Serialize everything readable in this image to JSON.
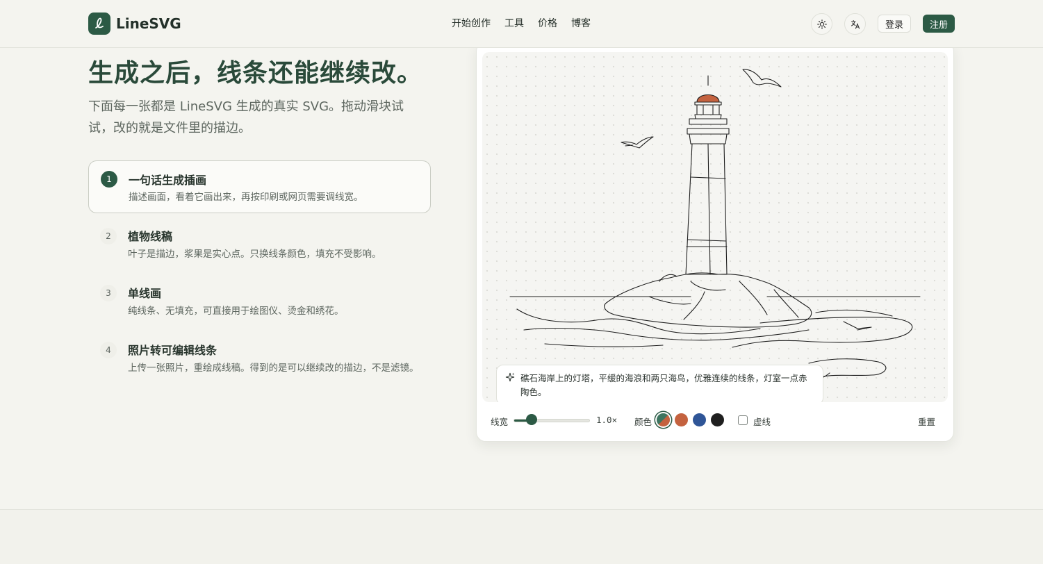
{
  "header": {
    "brand": "LineSVG",
    "nav": [
      "开始创作",
      "工具",
      "价格",
      "博客"
    ],
    "theme_icon": "sun-icon",
    "lang_icon": "translate-icon",
    "login": "登录",
    "signup": "注册"
  },
  "hero": {
    "title": "生成之后，线条还能继续改。",
    "subtitle": "下面每一张都是 LineSVG 生成的真实 SVG。拖动滑块试试，改的就是文件里的描边。"
  },
  "steps": [
    {
      "num": "1",
      "title": "一句话生成插画",
      "desc": "描述画面，看着它画出来，再按印刷或网页需要调线宽。",
      "active": true
    },
    {
      "num": "2",
      "title": "植物线稿",
      "desc": "叶子是描边，浆果是实心点。只换线条颜色，填充不受影响。",
      "active": false
    },
    {
      "num": "3",
      "title": "单线画",
      "desc": "纯线条、无填充，可直接用于绘图仪、烫金和绣花。",
      "active": false
    },
    {
      "num": "4",
      "title": "照片转可编辑线条",
      "desc": "上传一张照片，重绘成线稿。得到的是可以继续改的描边，不是滤镜。",
      "active": false
    }
  ],
  "preview": {
    "prompt": "礁石海岸上的灯塔，平缓的海浪和两只海鸟，优雅连续的线条，灯室一点赤陶色。",
    "prompt_icon": "sparkle-icon"
  },
  "controls": {
    "stroke_label": "线宽",
    "stroke_value": "1.0×",
    "stroke_fraction": 0.24,
    "color_label": "颜色",
    "colors": [
      "#3e7560",
      "#c4623f",
      "#2f5597",
      "#1f1f1f"
    ],
    "selected_color": 0,
    "dashed_label": "虚线",
    "dashed": false,
    "reset": "重置"
  }
}
